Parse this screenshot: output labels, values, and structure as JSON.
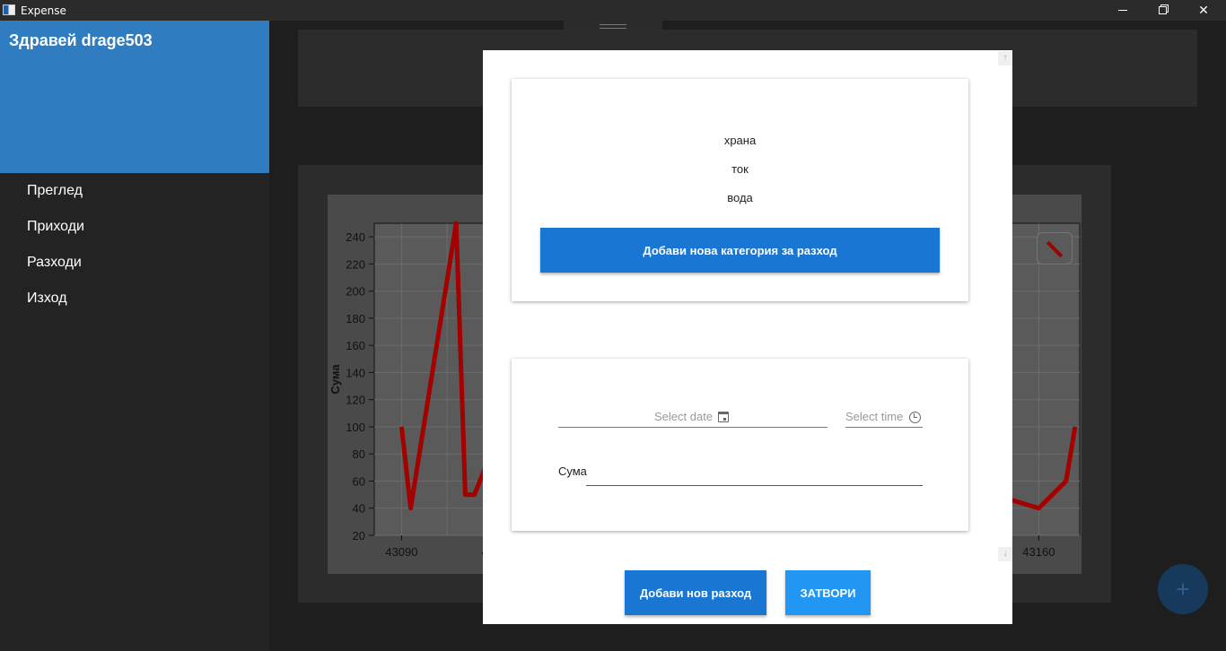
{
  "window": {
    "title": "Expense",
    "minimize": "—",
    "maximize": "❐",
    "close": "✕"
  },
  "sidebar": {
    "greeting": "Здравей drage503",
    "items": [
      {
        "label": "Преглед"
      },
      {
        "label": "Приходи"
      },
      {
        "label": "Разходи"
      },
      {
        "label": "Изход"
      }
    ]
  },
  "chart_data": {
    "type": "line",
    "ylabel": "Сума",
    "ylim": [
      20,
      250
    ],
    "yticks": [
      20,
      40,
      60,
      80,
      100,
      120,
      140,
      160,
      180,
      200,
      220,
      240
    ],
    "xticks_visible": [
      "43090",
      "4310",
      "43160"
    ],
    "series": [
      {
        "x": [
          43090,
          43091,
          43096,
          43097,
          43098,
          43101,
          43102
        ],
        "values": [
          100,
          40,
          250,
          50,
          50,
          100,
          50
        ]
      },
      {
        "x": [
          43155,
          43160,
          43163,
          43164
        ],
        "values": [
          50,
          40,
          60,
          100
        ]
      }
    ],
    "line_color": "#a30000"
  },
  "modal": {
    "categories": [
      "храна",
      "ток",
      "вода"
    ],
    "add_category_label": "Добави нова категория за разход",
    "date_placeholder": "Select date",
    "time_placeholder": "Select time",
    "amount_label": "Сума",
    "amount_value": "",
    "add_expense_label": "Добави нов разход",
    "close_label": "ЗАТВОРИ"
  },
  "fab_label": "+"
}
